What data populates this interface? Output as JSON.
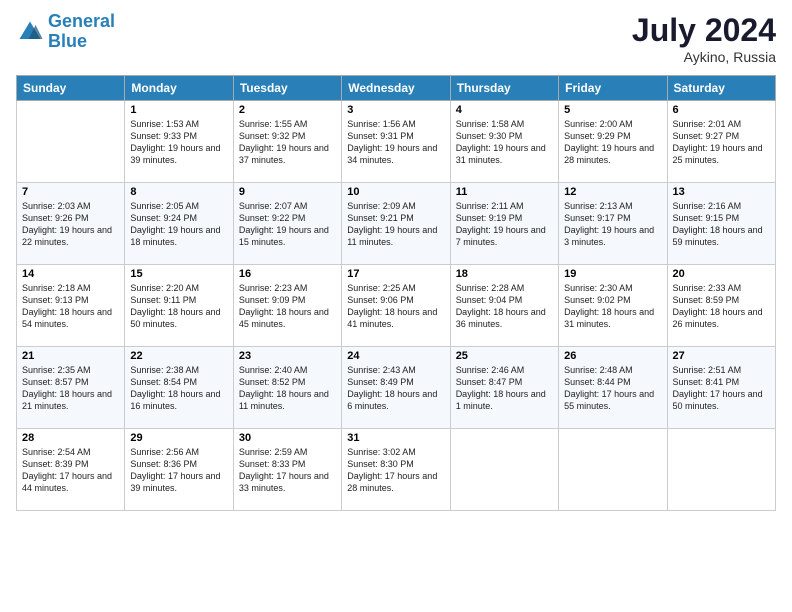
{
  "header": {
    "logo_line1": "General",
    "logo_line2": "Blue",
    "month_year": "July 2024",
    "location": "Aykino, Russia"
  },
  "days_of_week": [
    "Sunday",
    "Monday",
    "Tuesday",
    "Wednesday",
    "Thursday",
    "Friday",
    "Saturday"
  ],
  "weeks": [
    [
      {
        "day": "",
        "info": ""
      },
      {
        "day": "1",
        "info": "Sunrise: 1:53 AM\nSunset: 9:33 PM\nDaylight: 19 hours and 39 minutes."
      },
      {
        "day": "2",
        "info": "Sunrise: 1:55 AM\nSunset: 9:32 PM\nDaylight: 19 hours and 37 minutes."
      },
      {
        "day": "3",
        "info": "Sunrise: 1:56 AM\nSunset: 9:31 PM\nDaylight: 19 hours and 34 minutes."
      },
      {
        "day": "4",
        "info": "Sunrise: 1:58 AM\nSunset: 9:30 PM\nDaylight: 19 hours and 31 minutes."
      },
      {
        "day": "5",
        "info": "Sunrise: 2:00 AM\nSunset: 9:29 PM\nDaylight: 19 hours and 28 minutes."
      },
      {
        "day": "6",
        "info": "Sunrise: 2:01 AM\nSunset: 9:27 PM\nDaylight: 19 hours and 25 minutes."
      }
    ],
    [
      {
        "day": "7",
        "info": "Sunrise: 2:03 AM\nSunset: 9:26 PM\nDaylight: 19 hours and 22 minutes."
      },
      {
        "day": "8",
        "info": "Sunrise: 2:05 AM\nSunset: 9:24 PM\nDaylight: 19 hours and 18 minutes."
      },
      {
        "day": "9",
        "info": "Sunrise: 2:07 AM\nSunset: 9:22 PM\nDaylight: 19 hours and 15 minutes."
      },
      {
        "day": "10",
        "info": "Sunrise: 2:09 AM\nSunset: 9:21 PM\nDaylight: 19 hours and 11 minutes."
      },
      {
        "day": "11",
        "info": "Sunrise: 2:11 AM\nSunset: 9:19 PM\nDaylight: 19 hours and 7 minutes."
      },
      {
        "day": "12",
        "info": "Sunrise: 2:13 AM\nSunset: 9:17 PM\nDaylight: 19 hours and 3 minutes."
      },
      {
        "day": "13",
        "info": "Sunrise: 2:16 AM\nSunset: 9:15 PM\nDaylight: 18 hours and 59 minutes."
      }
    ],
    [
      {
        "day": "14",
        "info": "Sunrise: 2:18 AM\nSunset: 9:13 PM\nDaylight: 18 hours and 54 minutes."
      },
      {
        "day": "15",
        "info": "Sunrise: 2:20 AM\nSunset: 9:11 PM\nDaylight: 18 hours and 50 minutes."
      },
      {
        "day": "16",
        "info": "Sunrise: 2:23 AM\nSunset: 9:09 PM\nDaylight: 18 hours and 45 minutes."
      },
      {
        "day": "17",
        "info": "Sunrise: 2:25 AM\nSunset: 9:06 PM\nDaylight: 18 hours and 41 minutes."
      },
      {
        "day": "18",
        "info": "Sunrise: 2:28 AM\nSunset: 9:04 PM\nDaylight: 18 hours and 36 minutes."
      },
      {
        "day": "19",
        "info": "Sunrise: 2:30 AM\nSunset: 9:02 PM\nDaylight: 18 hours and 31 minutes."
      },
      {
        "day": "20",
        "info": "Sunrise: 2:33 AM\nSunset: 8:59 PM\nDaylight: 18 hours and 26 minutes."
      }
    ],
    [
      {
        "day": "21",
        "info": "Sunrise: 2:35 AM\nSunset: 8:57 PM\nDaylight: 18 hours and 21 minutes."
      },
      {
        "day": "22",
        "info": "Sunrise: 2:38 AM\nSunset: 8:54 PM\nDaylight: 18 hours and 16 minutes."
      },
      {
        "day": "23",
        "info": "Sunrise: 2:40 AM\nSunset: 8:52 PM\nDaylight: 18 hours and 11 minutes."
      },
      {
        "day": "24",
        "info": "Sunrise: 2:43 AM\nSunset: 8:49 PM\nDaylight: 18 hours and 6 minutes."
      },
      {
        "day": "25",
        "info": "Sunrise: 2:46 AM\nSunset: 8:47 PM\nDaylight: 18 hours and 1 minute."
      },
      {
        "day": "26",
        "info": "Sunrise: 2:48 AM\nSunset: 8:44 PM\nDaylight: 17 hours and 55 minutes."
      },
      {
        "day": "27",
        "info": "Sunrise: 2:51 AM\nSunset: 8:41 PM\nDaylight: 17 hours and 50 minutes."
      }
    ],
    [
      {
        "day": "28",
        "info": "Sunrise: 2:54 AM\nSunset: 8:39 PM\nDaylight: 17 hours and 44 minutes."
      },
      {
        "day": "29",
        "info": "Sunrise: 2:56 AM\nSunset: 8:36 PM\nDaylight: 17 hours and 39 minutes."
      },
      {
        "day": "30",
        "info": "Sunrise: 2:59 AM\nSunset: 8:33 PM\nDaylight: 17 hours and 33 minutes."
      },
      {
        "day": "31",
        "info": "Sunrise: 3:02 AM\nSunset: 8:30 PM\nDaylight: 17 hours and 28 minutes."
      },
      {
        "day": "",
        "info": ""
      },
      {
        "day": "",
        "info": ""
      },
      {
        "day": "",
        "info": ""
      }
    ]
  ]
}
